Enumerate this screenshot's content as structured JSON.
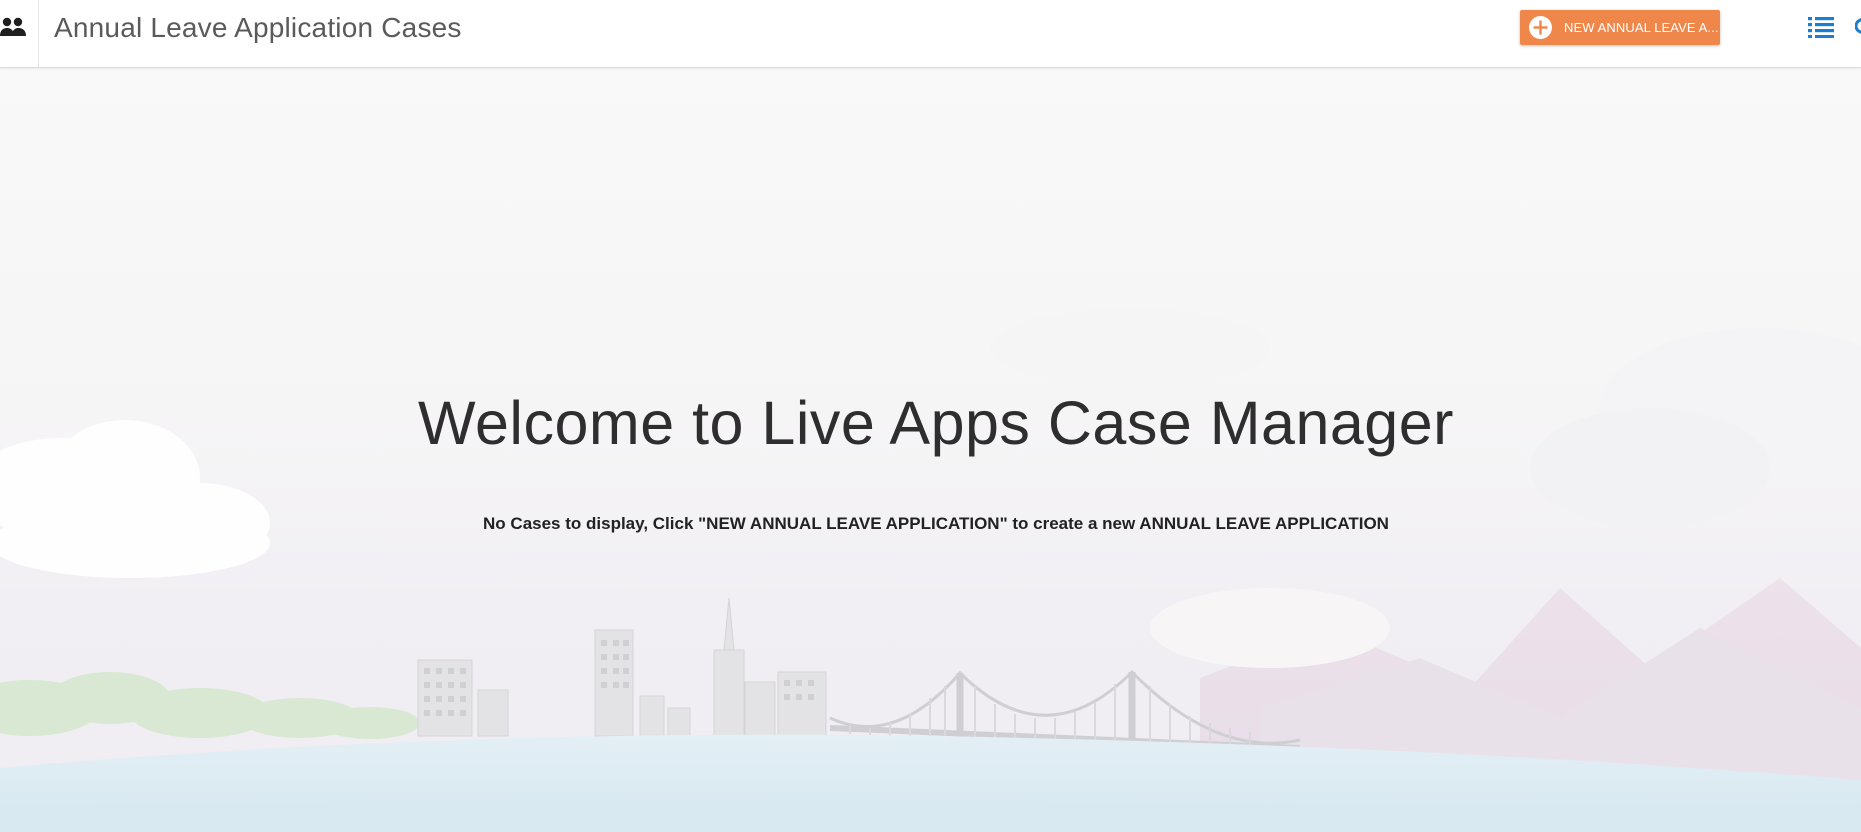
{
  "header": {
    "title": "Annual Leave Application Cases",
    "new_case_button_label": "NEW ANNUAL LEAVE A...",
    "people_icon": "people-icon",
    "list_view_icon": "list-view-icon"
  },
  "main": {
    "welcome_title": "Welcome to Live Apps Case Manager",
    "empty_message": "No Cases to display, Click \"NEW ANNUAL LEAVE APPLICATION\" to create a new ANNUAL LEAVE APPLICATION"
  },
  "colors": {
    "accent_orange": "#f0874a",
    "icon_blue": "#1a7fd0",
    "header_bg": "#ffffff",
    "title_text": "#5a5a5a"
  }
}
